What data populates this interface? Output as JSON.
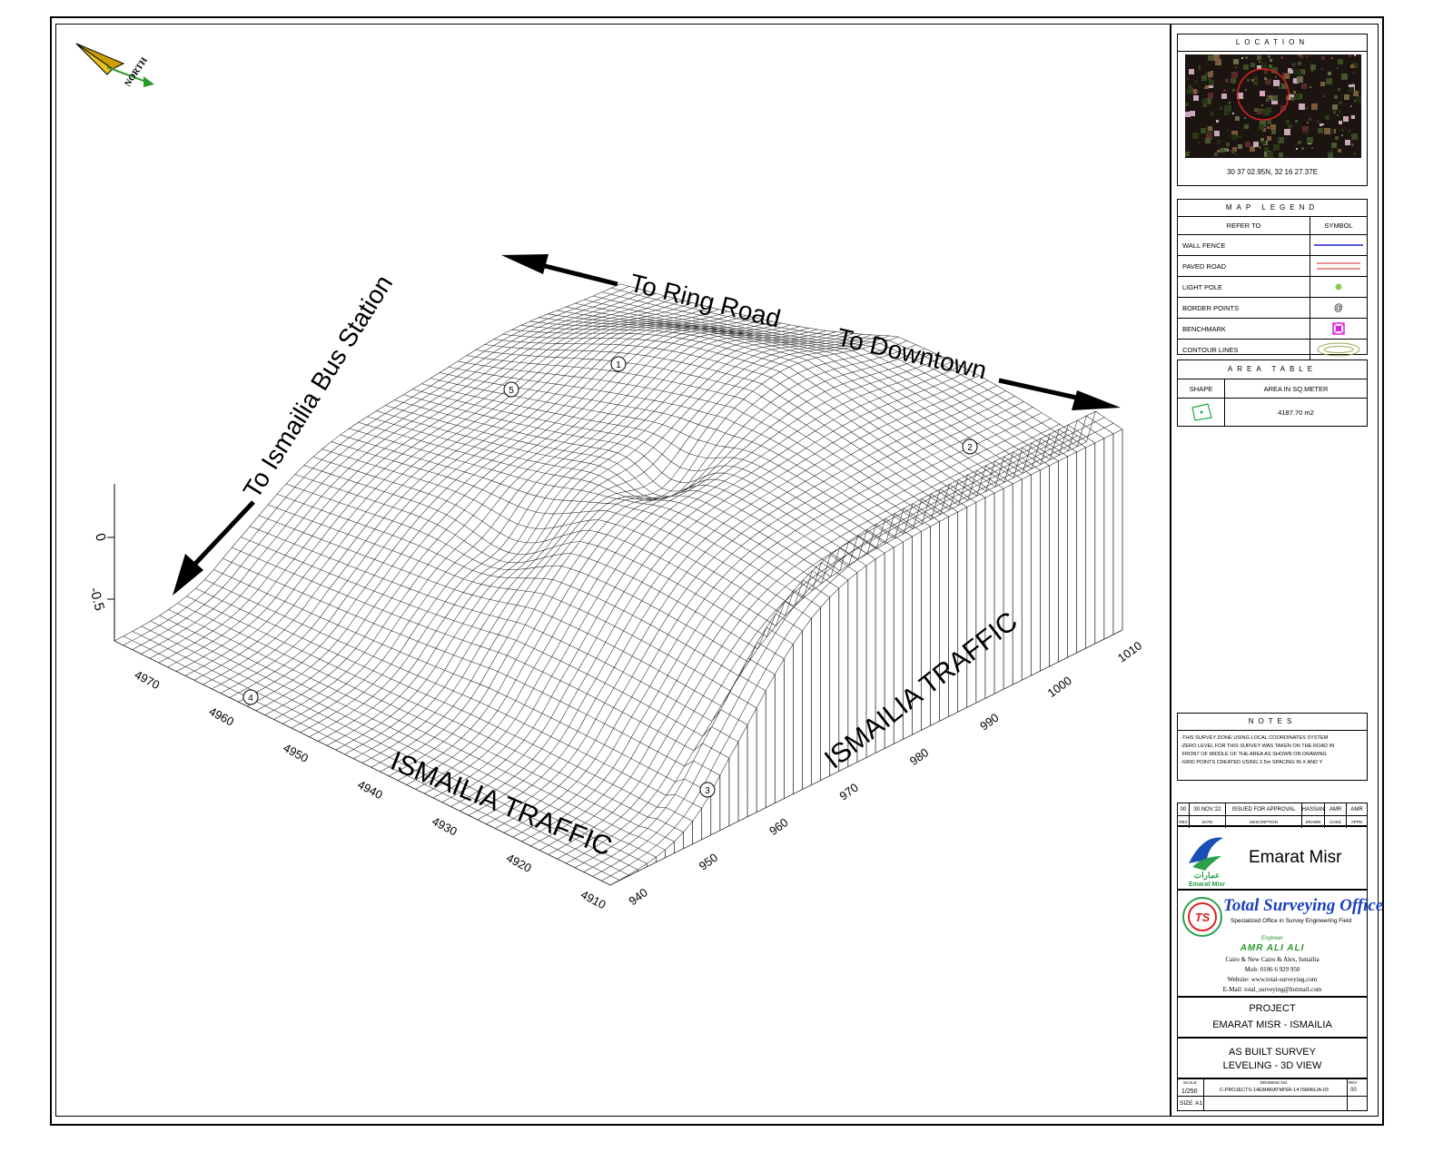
{
  "compass": {
    "label": "NORTH"
  },
  "directions": {
    "ring_road": "To Ring Road",
    "downtown": "To Downtown",
    "bus_station": "To Ismailia Bus Station",
    "traffic_front": "ISMAILIA TRAFFIC",
    "traffic_right": "ISMAILIA TRAFFIC"
  },
  "axes": {
    "z_ticks": [
      "0",
      "-0.5"
    ],
    "y_ticks": [
      "4970",
      "4960",
      "4950",
      "4940",
      "4930",
      "4920",
      "4910"
    ],
    "x_ticks": [
      "940",
      "950",
      "960",
      "970",
      "980",
      "990",
      "1000",
      "1010"
    ]
  },
  "point_labels": [
    "1",
    "2",
    "3",
    "4",
    "5"
  ],
  "location": {
    "title": "LOCATION",
    "coords": "30 37 02.95N, 32 16 27.37E"
  },
  "legend": {
    "title": "MAP LEGEND",
    "col_refer": "REFER TO",
    "col_symbol": "SYMBOL",
    "items": [
      {
        "label": "WALL FENCE",
        "symbol": "blue-line-icon",
        "color": "#2222cc"
      },
      {
        "label": "PAVED ROAD",
        "symbol": "red-double-line-icon",
        "color": "#cc2222"
      },
      {
        "label": "LIGHT POLE",
        "symbol": "green-dot-icon",
        "color": "#88cc55"
      },
      {
        "label": "BORDER POINTS",
        "symbol": "at-icon",
        "color": "#000000"
      },
      {
        "label": "BENCHMARK",
        "symbol": "benchmark-icon",
        "color": "#dd22dd"
      },
      {
        "label": "CONTOUR LINES",
        "symbol": "contour-icon",
        "color": "#99aa55"
      }
    ]
  },
  "area_table": {
    "title": "AREA TABLE",
    "col_shape": "SHAPE",
    "col_area": "AREA IN SQ.METER",
    "value": "4187.70  m2"
  },
  "notes": {
    "title": "NOTES",
    "lines": [
      "-THIS SURVEY DONE USING LOCAL COORDINATES SYSTEM",
      "-ZERO LEVEL FOR THIS SURVEY WAS TAKEN ON THE ROAD IN",
      " FRONT OF MIDDLE OF THE AREA AS SHOWN ON DRAWING",
      "-GRID POINTS CREATED USING 2.5m SPACING IN X AND Y"
    ]
  },
  "revision": {
    "rev": "00",
    "date": "30.NOV.'22",
    "description": "ISSUED FOR APPROVAL",
    "drawn": "HASSAN",
    "checked": "AMR",
    "approved": "AMR",
    "h_rev": "REV",
    "h_date": "DATE",
    "h_desc": "DESCRIPTION",
    "h_drawn": "DRAWN",
    "h_checked": "CHKD",
    "h_approved": "APPD"
  },
  "client": {
    "name": "Emarat Misr",
    "logo_text": "Emarat Misr"
  },
  "office": {
    "name": "Total Surveying Office",
    "tagline": "Specialized Office in Survey Engineering Field",
    "engineer_title": "Engineer",
    "engineer": "AMR ALI ALI",
    "address": "Cairo & New Cairo & Alex, Ismailia",
    "mobile": "Mob: 0106 6 929 950",
    "website": "Website: www.total-surveying.com",
    "email": "E-Mail: total_surveying@hotmail.com"
  },
  "project": {
    "label": "PROJECT",
    "name": "EMARAT MISR  -  ISMAILIA"
  },
  "drawing_title": {
    "line1": "AS  BUILT  SURVEY",
    "line2": "LEVELING  -  3D  VIEW"
  },
  "footer": {
    "scale_label": "SCALE",
    "scale": "1/250",
    "size_label": "SIZE",
    "size": "A1",
    "drawing_no_label": "DRAWING NO.",
    "drawing_no": "C-PROJECTS-14EMARATMISR-14 ISMAILIA-03",
    "rev_label": "REV",
    "rev": "00",
    "sub1": "",
    "sub2": ""
  }
}
